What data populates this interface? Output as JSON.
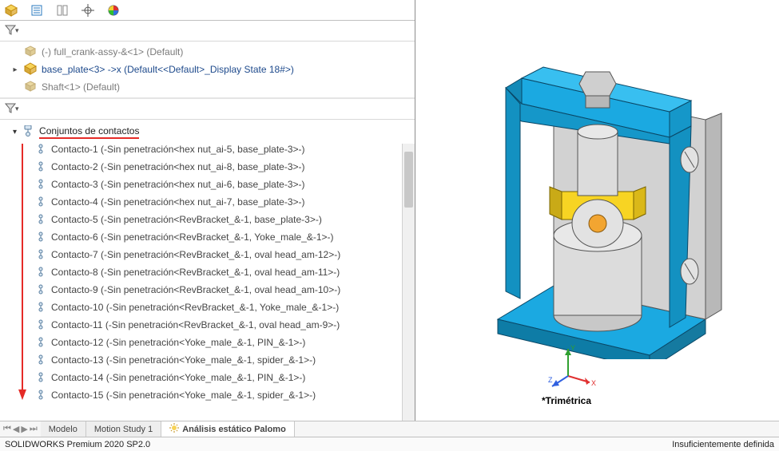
{
  "components": {
    "row1": "(-) full_crank-assy-&<1> (Default)",
    "row2": "base_plate<3> ->x (Default<<Default>_Display State 18#>)",
    "row3": "Shaft<1> (Default)"
  },
  "study": {
    "header": "Conjuntos de contactos",
    "contacts": [
      "Contacto-1 (-Sin penetración<hex nut_ai-5, base_plate-3>-)",
      "Contacto-2 (-Sin penetración<hex nut_ai-8, base_plate-3>-)",
      "Contacto-3 (-Sin penetración<hex nut_ai-6, base_plate-3>-)",
      "Contacto-4 (-Sin penetración<hex nut_ai-7, base_plate-3>-)",
      "Contacto-5 (-Sin penetración<RevBracket_&-1, base_plate-3>-)",
      "Contacto-6 (-Sin penetración<RevBracket_&-1, Yoke_male_&-1>-)",
      "Contacto-7 (-Sin penetración<RevBracket_&-1, oval head_am-12>-)",
      "Contacto-8 (-Sin penetración<RevBracket_&-1, oval head_am-11>-)",
      "Contacto-9 (-Sin penetración<RevBracket_&-1, oval head_am-10>-)",
      "Contacto-10 (-Sin penetración<RevBracket_&-1, Yoke_male_&-1>-)",
      "Contacto-11 (-Sin penetración<RevBracket_&-1, oval head_am-9>-)",
      "Contacto-12 (-Sin penetración<Yoke_male_&-1, PIN_&-1>-)",
      "Contacto-13 (-Sin penetración<Yoke_male_&-1, spider_&-1>-)",
      "Contacto-14 (-Sin penetración<Yoke_male_&-1, PIN_&-1>-)",
      "Contacto-15 (-Sin penetración<Yoke_male_&-1, spider_&-1>-)"
    ]
  },
  "bottomTabs": {
    "modelo": "Modelo",
    "motion": "Motion Study 1",
    "analysis": "Análisis estático Palomo"
  },
  "status": {
    "left": "SOLIDWORKS Premium 2020 SP2.0",
    "right": "Insuficientemente definida"
  },
  "viewport": {
    "label": "*Trimétrica",
    "axes": {
      "x": "X",
      "y": "Y",
      "z": "Z"
    }
  }
}
